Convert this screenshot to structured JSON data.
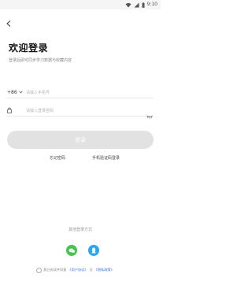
{
  "status_bar": {
    "time": "9:10"
  },
  "header": {
    "back_icon": "chevron-left-icon",
    "title": "欢迎登录",
    "subtitle": "登录后即可同步学习数据与收藏内容"
  },
  "form": {
    "country_code": "+86",
    "phone_placeholder": "请输入手机号",
    "password_placeholder": "请输入登录密码",
    "login_label": "登录"
  },
  "links": {
    "forgot_password": "忘记密码",
    "sms_login": "手机验证码登录"
  },
  "other_login": {
    "label": "其他登录方式",
    "wechat_icon": "wechat-icon",
    "qq_icon": "qq-icon"
  },
  "agreement": {
    "prefix": "我已阅读并同意",
    "user_agreement": "《用户协议》",
    "and": "及",
    "privacy_policy": "《隐私政策》"
  },
  "colors": {
    "button_disabled": "#e2e2e2",
    "wechat": "#4cbf55",
    "qq": "#2aa5f0",
    "link": "#3b6fd4"
  }
}
